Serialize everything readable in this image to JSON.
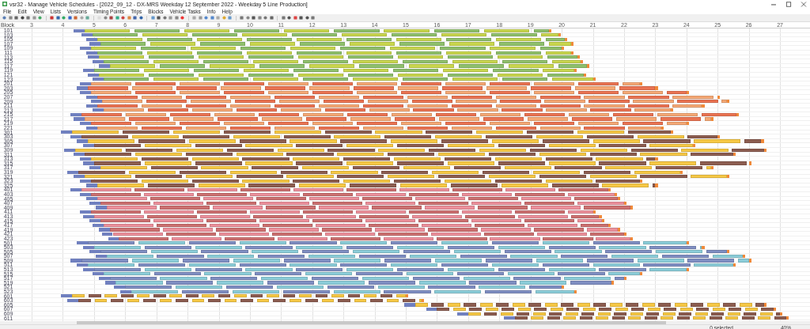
{
  "window": {
    "title": "vsr32 - Manage Vehicle Schedules - [2022_09_12 - DX-MRS Weekday 12 September 2022 - Weekday 5 Line Production]"
  },
  "menu": [
    "File",
    "Edit",
    "View",
    "Lists",
    "Versions",
    "Timing Points",
    "Trips",
    "Blocks",
    "Vehicle Tasks",
    "Info",
    "Help"
  ],
  "schedule": {
    "block_header": "Block",
    "hours": [
      "3",
      "4",
      "5",
      "6",
      "7",
      "8",
      "9",
      "10",
      "11",
      "12",
      "13",
      "14",
      "15",
      "16",
      "17",
      "18",
      "19",
      "20",
      "21",
      "22",
      "23",
      "24",
      "25",
      "26",
      "27"
    ],
    "groups": [
      {
        "trip_colors": [
          {
            "color": "#c9d64e"
          },
          {
            "color": "#8fc06c"
          }
        ],
        "blocks": [
          "101",
          "103",
          "105",
          "107",
          "109",
          "111",
          "113",
          "115",
          "117",
          "119",
          "121",
          "123"
        ]
      },
      {
        "trip_colors": [
          {
            "color": "#f5a875"
          },
          {
            "color": "#ea7352"
          }
        ],
        "blocks": [
          "201",
          "203",
          "205",
          "207",
          "209",
          "211",
          "213",
          "215",
          "217",
          "219",
          "221"
        ]
      },
      {
        "trip_colors": [
          {
            "color": "#f6c845"
          },
          {
            "color": "#8c5d50"
          }
        ],
        "blocks": [
          "301",
          "303",
          "305",
          "307",
          "309",
          "311",
          "313",
          "315",
          "317",
          "319",
          "321",
          "323",
          "325"
        ]
      },
      {
        "trip_colors": [
          {
            "color": "#ec909b"
          },
          {
            "color": "#cc7070"
          }
        ],
        "blocks": [
          "401",
          "403",
          "405",
          "407",
          "409",
          "411",
          "413",
          "415",
          "417",
          "419",
          "421",
          "423"
        ]
      },
      {
        "trip_colors": [
          {
            "color": "#7f8ec2"
          },
          {
            "color": "#8bcdd9"
          }
        ],
        "blocks": [
          "501",
          "503",
          "505",
          "507",
          "509",
          "511",
          "513",
          "515",
          "517",
          "519",
          "521",
          "523"
        ]
      },
      {
        "trip_colors": [
          {
            "color": "#f6c845"
          },
          {
            "color": "#8c5d50"
          }
        ],
        "blocks": [
          "601",
          "603",
          "605",
          "607",
          "609",
          "611"
        ]
      }
    ]
  },
  "status_bar": {
    "selection": "0 selected",
    "zoom": "40%"
  }
}
